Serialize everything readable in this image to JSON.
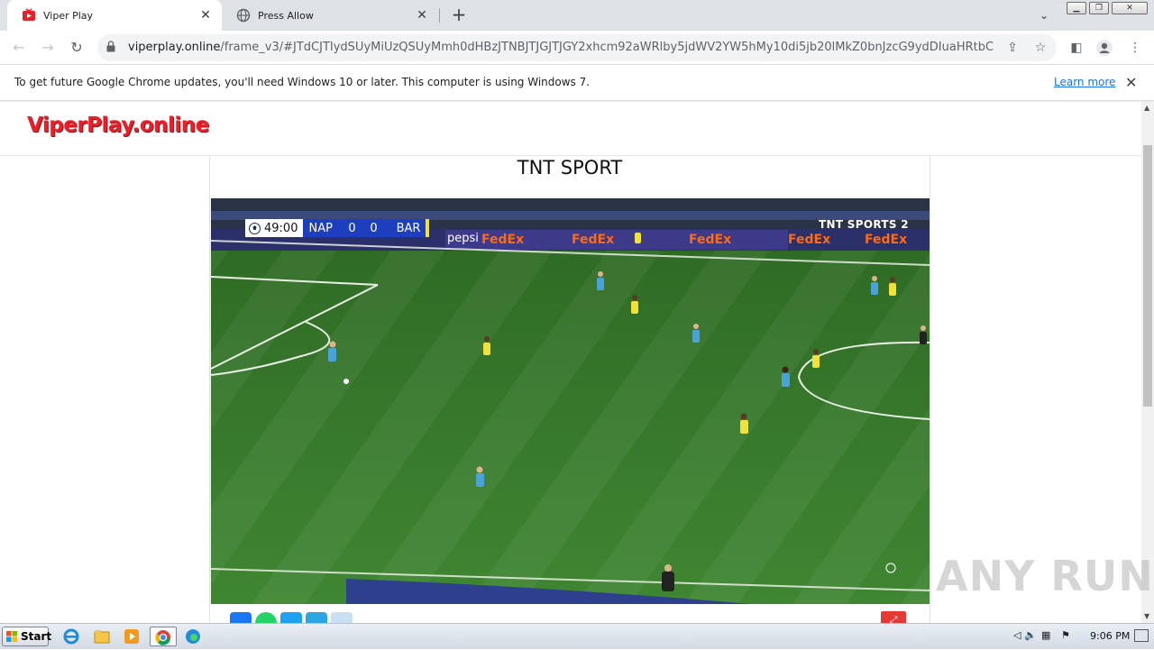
{
  "tabs": [
    {
      "title": "Viper Play",
      "active": true,
      "icon": "viperplay-favicon"
    },
    {
      "title": "Press Allow",
      "active": false,
      "icon": "globe-icon"
    }
  ],
  "toolbar": {
    "url_host": "viperplay.online",
    "url_path": "/frame_v3/#JTdCJTIydSUyMiUzQSUyMmh0dHBzJTNBJTJGJTJGY2xhcm92aWRlby5jdWV2YW5hMy10di5jb20lMkZ0bnJzcG9ydDIuaHRtbCU..."
  },
  "infobar": {
    "message": "To get future Google Chrome updates, you'll need Windows 10 or later. This computer is using Windows 7.",
    "link": "Learn more"
  },
  "site": {
    "logo": "ViperPlay.online",
    "channel_title": "TNT SPORT"
  },
  "scoreboard": {
    "clock": "49:00",
    "home": "NAP",
    "home_score": "0",
    "away_score": "0",
    "away": "BAR",
    "broadcaster": "TNT SPORTS 2"
  },
  "ad_boards": [
    "FedEx",
    "pepsi"
  ],
  "share_colors": [
    "#1877f2",
    "#25d366",
    "#1da1f2",
    "#2ca5e0",
    "#c9dff3"
  ],
  "watermark": "ANY RUN",
  "taskbar": {
    "start": "Start",
    "clock": "9:06 PM"
  },
  "colors": {
    "logo": "#e8202a",
    "pitch": "#3b7a2c",
    "home_kit": "#4aa3d8",
    "away_kit": "#f2e03b"
  }
}
